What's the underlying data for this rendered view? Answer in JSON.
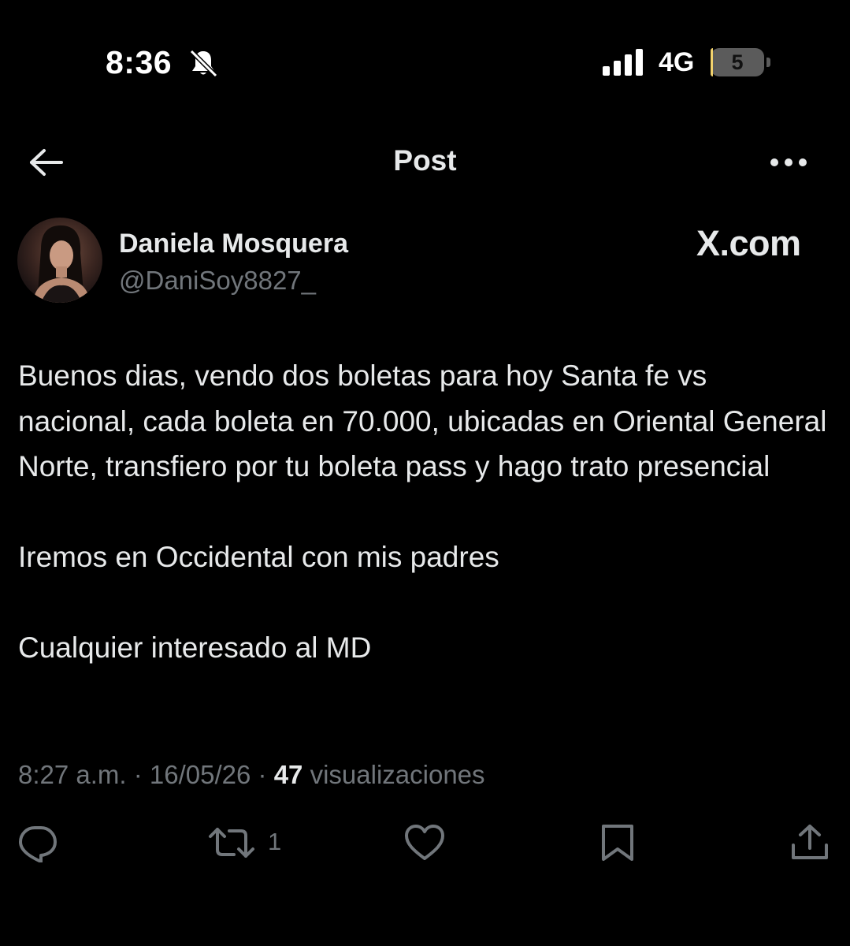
{
  "status_bar": {
    "time": "8:36",
    "network": "4G",
    "battery_level": "5",
    "battery_fraction": 0.05,
    "icons": [
      "bell-slash-icon",
      "signal-bars-icon",
      "battery-icon"
    ]
  },
  "header": {
    "title": "Post",
    "back_icon": "arrow-left-icon",
    "more_icon": "more-horizontal-icon"
  },
  "author": {
    "name": "Daniela Mosquera",
    "handle": "@DaniSoy8827_"
  },
  "watermark": "X.com",
  "post": {
    "paragraphs": [
      "Buenos dias, vendo dos boletas para hoy Santa fe vs nacional, cada boleta en 70.000, ubicadas en Oriental General Norte, transfiero por tu boleta pass y hago trato presencial",
      "Iremos en Occidental con mis padres",
      "Cualquier interesado al MD"
    ]
  },
  "meta": {
    "time": "8:27 a.m.",
    "separator": " · ",
    "date": "16/05/26",
    "views_count": "47",
    "views_label": " visualizaciones"
  },
  "actions": {
    "reply_icon": "reply-icon",
    "repost_icon": "repost-icon",
    "repost_count": "1",
    "like_icon": "heart-icon",
    "bookmark_icon": "bookmark-icon",
    "share_icon": "share-icon"
  },
  "colors": {
    "background": "#000000",
    "primary_text": "#e7e9ea",
    "secondary_text": "#71767b",
    "battery_fill": "#f2d26d"
  }
}
